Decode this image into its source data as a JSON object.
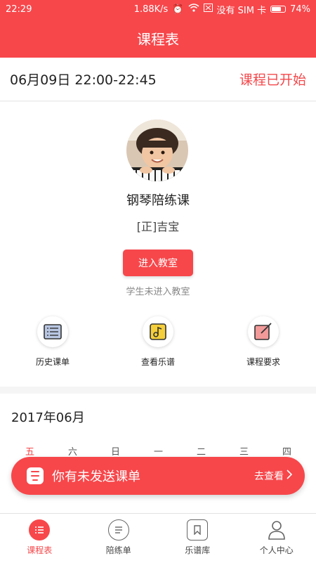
{
  "status_bar": {
    "time": "22:29",
    "speed": "1.88K/s",
    "sim": "没有 SIM 卡",
    "battery": "74%",
    "battery_level": 0.74
  },
  "header": {
    "title": "课程表"
  },
  "course": {
    "datetime": "06月09日 22:00-22:45",
    "status": "课程已开始",
    "name": "钢琴陪练课",
    "student": "[正]吉宝",
    "enter_button": "进入教室",
    "enter_hint": "学生未进入教室"
  },
  "actions": [
    {
      "label": "历史课单",
      "icon": "list-icon"
    },
    {
      "label": "查看乐谱",
      "icon": "music-note-icon"
    },
    {
      "label": "课程要求",
      "icon": "edit-icon"
    }
  ],
  "calendar": {
    "month": "2017年06月",
    "weekdays": [
      "五",
      "六",
      "日",
      "一",
      "二",
      "三",
      "四"
    ]
  },
  "banner": {
    "text": "你有未发送课单",
    "link": "去查看"
  },
  "tabs": [
    {
      "label": "课程表",
      "icon": "schedule-icon",
      "active": true
    },
    {
      "label": "陪练单",
      "icon": "sheet-icon",
      "active": false
    },
    {
      "label": "乐谱库",
      "icon": "bookmark-icon",
      "active": false
    },
    {
      "label": "个人中心",
      "icon": "user-icon",
      "active": false
    }
  ],
  "colors": {
    "accent": "#f7474b"
  }
}
